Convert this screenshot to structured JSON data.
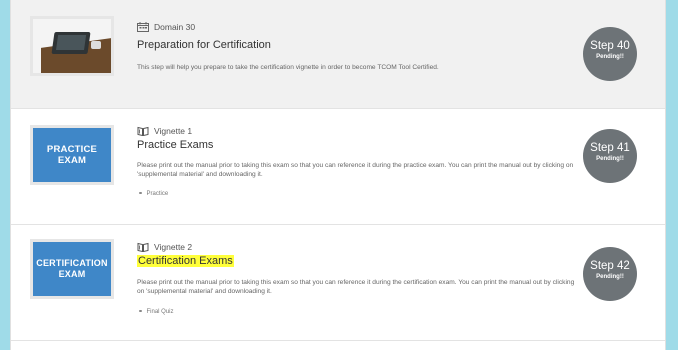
{
  "steps": [
    {
      "meta_label": "Domain 30",
      "meta_icon": "calendar-icon",
      "title": "Preparation for Certification",
      "description": "This step will help you prepare to take the certification vignette in order to become TCOM Tool Certified.",
      "tag": "",
      "step_label": "Step 40",
      "status": "Pending!!",
      "thumbnail": "laptop-photo"
    },
    {
      "meta_label": "Vignette 1",
      "meta_icon": "book-icon",
      "title": "Practice Exams",
      "description": "Please print out the manual prior to taking this exam so that you can reference it during the practice exam. You can print the manual out by clicking on 'supplemental material' and downloading it.",
      "tag": "Practice",
      "step_label": "Step 41",
      "status": "Pending!!",
      "thumbnail_text": "PRACTICE EXAM"
    },
    {
      "meta_label": "Vignette 2",
      "meta_icon": "book-icon",
      "title": "Certification Exams",
      "description": "Please print out the manual prior to taking this exam so that you can reference it during the certification exam. You can print the manual out by clicking on 'supplemental material' and downloading it.",
      "tag": "Final Quiz",
      "step_label": "Step 42",
      "status": "Pending!!",
      "thumbnail_text": "CERTIFICATION EXAM"
    }
  ],
  "colors": {
    "page_background": "#9fdbe8",
    "tile_blue": "#3f87c8",
    "step_circle": "#6d7377",
    "highlight": "#ffff3a"
  }
}
